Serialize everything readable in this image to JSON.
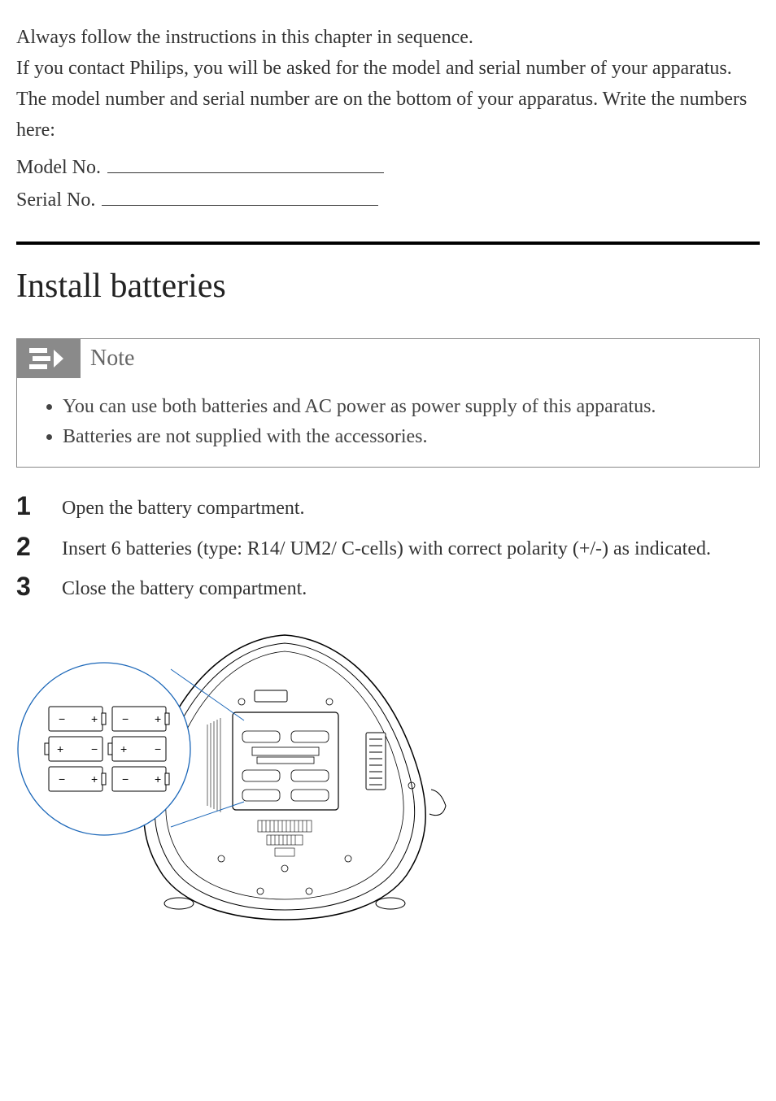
{
  "intro": {
    "line1": "Always follow the instructions in this chapter in sequence.",
    "line2": "If you contact Philips, you will be asked for the model and serial number of your apparatus. The model number and serial number are on the bottom of your apparatus. Write the numbers here:"
  },
  "fill_in": {
    "model_label": "Model No.",
    "serial_label": "Serial No."
  },
  "section_heading": "Install batteries",
  "note": {
    "title": "Note",
    "items": [
      "You can use both batteries and AC power as power supply of this apparatus.",
      "Batteries are not supplied with the accessories."
    ]
  },
  "steps": [
    "Open the battery compartment.",
    "Insert 6 batteries (type: R14/ UM2/ C-cells) with correct polarity (+/-) as indicated.",
    "Close the battery compartment."
  ],
  "diagram": {
    "cells": [
      [
        "−",
        "+",
        "−",
        "+"
      ],
      [
        "+",
        "−",
        "+",
        "−"
      ],
      [
        "−",
        "+",
        "−",
        "+"
      ]
    ]
  }
}
